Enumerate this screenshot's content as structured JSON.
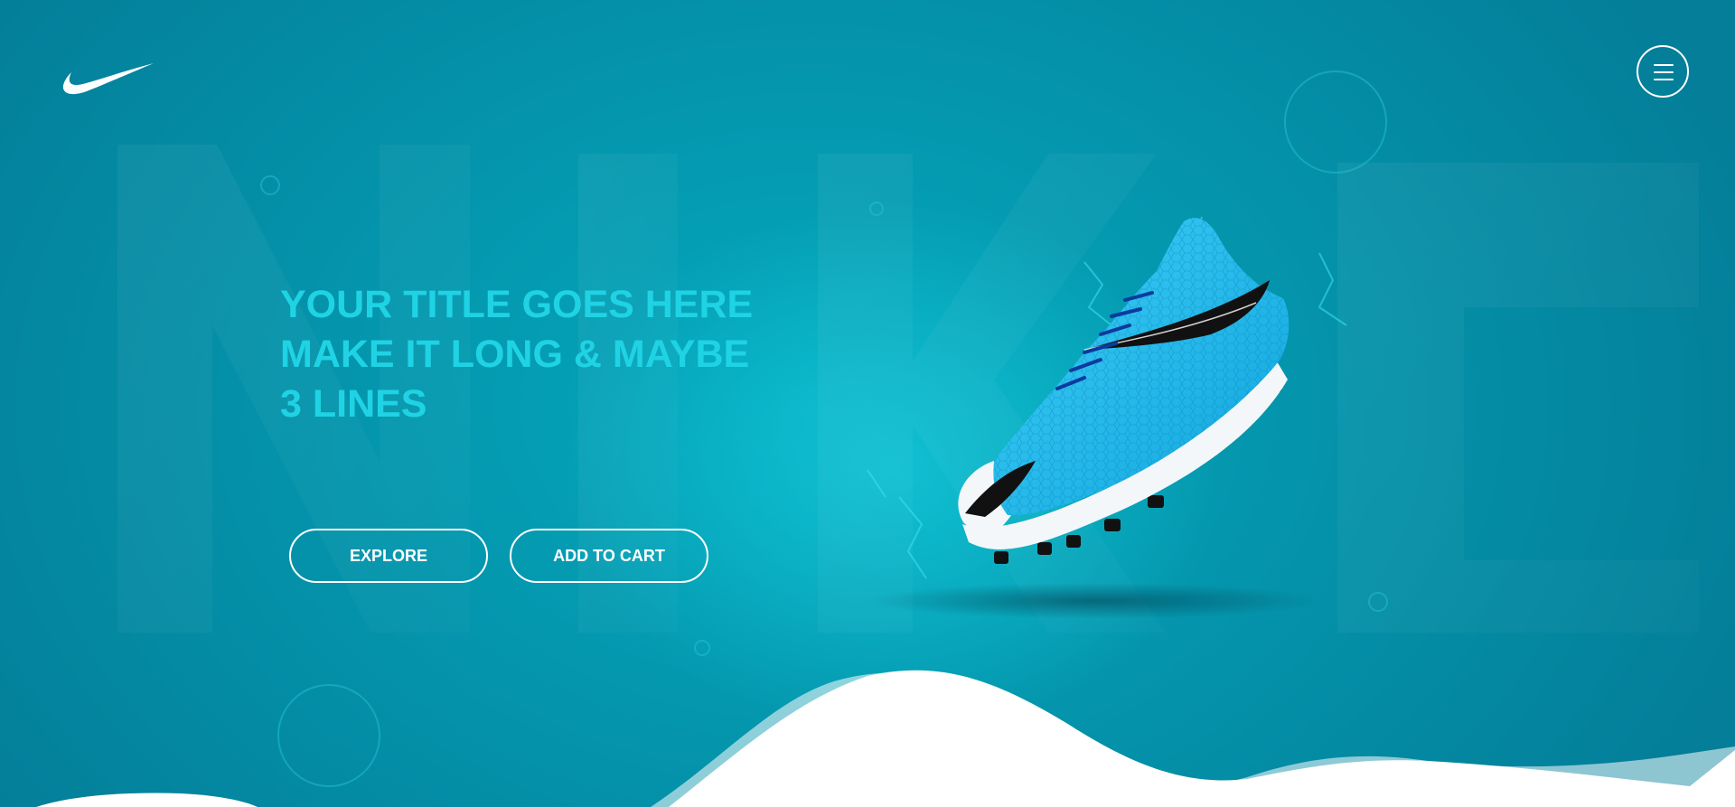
{
  "brand": {
    "logo_icon": "swoosh-logo-icon",
    "background_watermark": "NIKE"
  },
  "header": {
    "menu_icon": "hamburger-menu-icon"
  },
  "hero": {
    "title_lines": [
      "YOUR TITLE GOES HERE",
      "MAKE IT LONG & MAYBE",
      "3 LINES"
    ],
    "buttons": {
      "explore_label": "EXPLORE",
      "add_to_cart_label": "ADD TO CART"
    },
    "product_image": "soccer-cleat-image"
  },
  "colors": {
    "background": "#0496ad",
    "background_glow": "#19d7e6",
    "title_accent": "#1fd3e4",
    "button_outline": "#ffffff",
    "wave": "#ffffff",
    "shoe_primary": "#1cb8ea"
  }
}
